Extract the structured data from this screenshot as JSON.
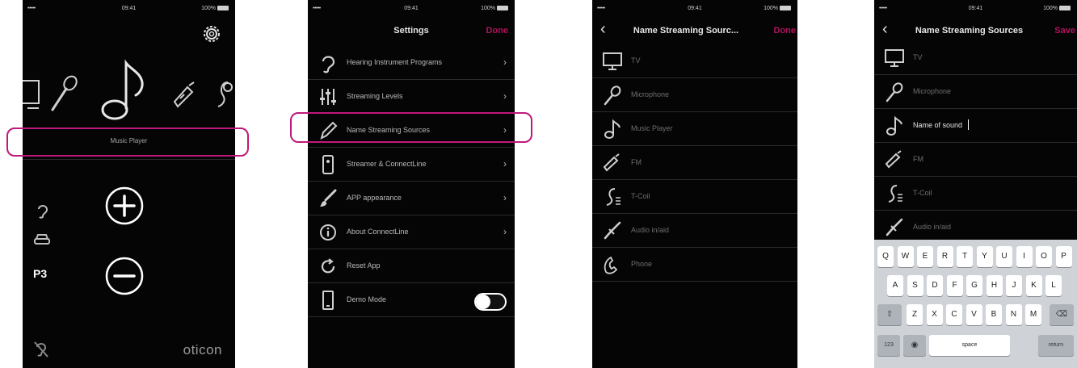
{
  "statusbar": {
    "signal": "•••••",
    "time": "09:41",
    "battery": "100%"
  },
  "screen1": {
    "source_label": "Music Player",
    "program": "P3",
    "brand": "oticon",
    "icons": [
      "settings-icon",
      "tv-icon",
      "microphone-icon",
      "music-note-icon",
      "fm-icon",
      "telecoil-icon",
      "ear-icon",
      "car-icon",
      "mute-icon"
    ]
  },
  "screen2": {
    "title": "Settings",
    "done": "Done",
    "items": [
      {
        "label": "Hearing Instrument Programs",
        "icon": "ear-icon"
      },
      {
        "label": "Streaming Levels",
        "icon": "sliders-icon"
      },
      {
        "label": "Name Streaming Sources",
        "icon": "pencil-icon"
      },
      {
        "label": "Streamer & ConnectLine",
        "icon": "streamer-icon"
      },
      {
        "label": "APP appearance",
        "icon": "brush-icon"
      },
      {
        "label": "About ConnectLine",
        "icon": "info-icon"
      },
      {
        "label": "Reset App",
        "icon": "reset-icon"
      },
      {
        "label": "Demo Mode",
        "icon": "phone-outline-icon"
      }
    ]
  },
  "screen3": {
    "title": "Name Streaming Sourc...",
    "done": "Done",
    "items": [
      {
        "label": "TV",
        "icon": "tv-icon"
      },
      {
        "label": "Microphone",
        "icon": "microphone-icon"
      },
      {
        "label": "Music Player",
        "icon": "music-note-icon"
      },
      {
        "label": "FM",
        "icon": "fm-icon"
      },
      {
        "label": "T-Coil",
        "icon": "telecoil-icon"
      },
      {
        "label": "Audio in/aid",
        "icon": "audio-jack-icon"
      },
      {
        "label": "Phone",
        "icon": "phone-handset-icon"
      }
    ]
  },
  "screen4": {
    "title": "Name Streaming Sources",
    "save": "Save",
    "items": [
      {
        "label": "TV",
        "icon": "tv-icon"
      },
      {
        "label": "Microphone",
        "icon": "microphone-icon"
      },
      {
        "label": "Name of sound",
        "icon": "music-note-icon"
      },
      {
        "label": "FM",
        "icon": "fm-icon"
      },
      {
        "label": "T-Coil",
        "icon": "telecoil-icon"
      },
      {
        "label": "Audio in/aid",
        "icon": "audio-jack-icon"
      }
    ],
    "keyboard": {
      "row1": [
        "Q",
        "W",
        "E",
        "R",
        "T",
        "Y",
        "U",
        "I",
        "O",
        "P"
      ],
      "row2": [
        "A",
        "S",
        "D",
        "F",
        "G",
        "H",
        "J",
        "K",
        "L"
      ],
      "row3": [
        "Z",
        "X",
        "C",
        "V",
        "B",
        "N",
        "M"
      ],
      "num": "123",
      "space": "space",
      "return": "return"
    }
  },
  "colors": {
    "accent": "#c0187a",
    "background": "#050505",
    "text": "#b9b9b9"
  }
}
